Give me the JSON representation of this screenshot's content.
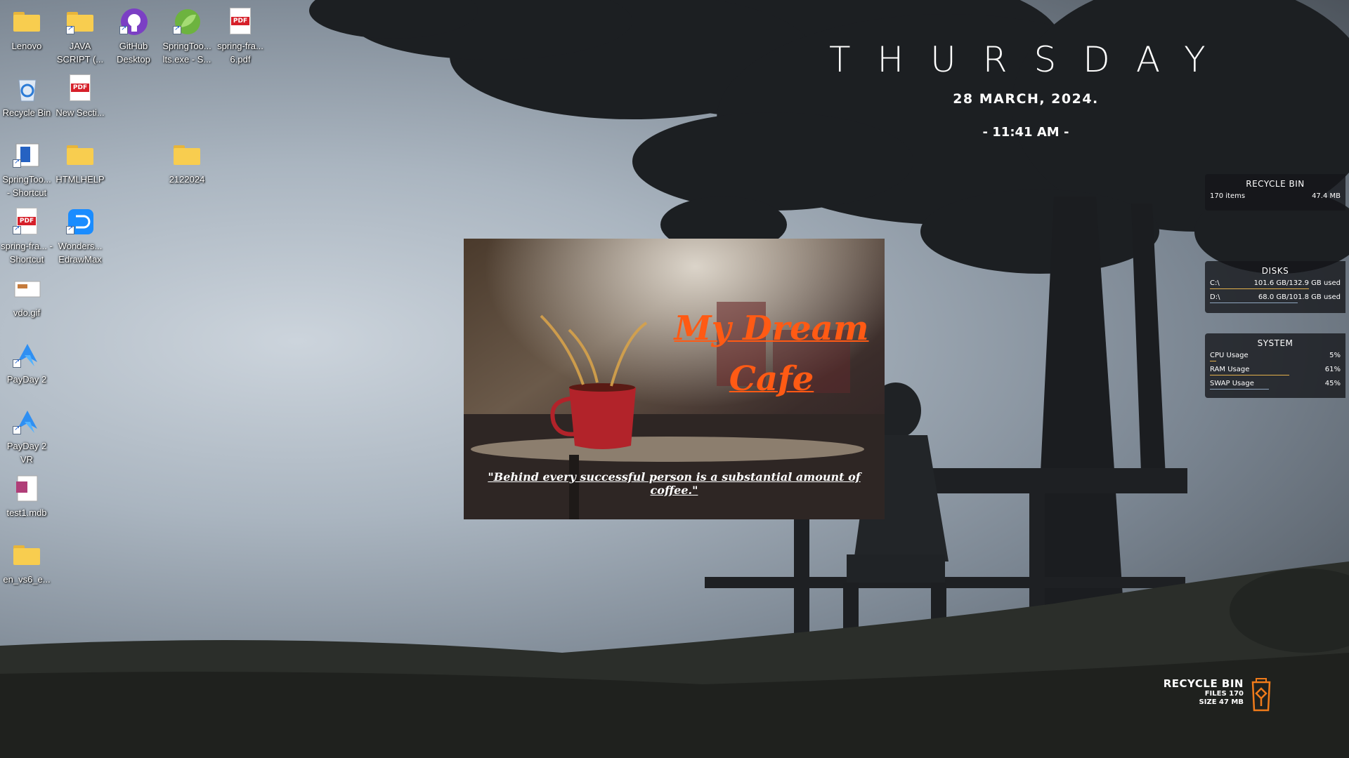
{
  "desktop_icons": [
    {
      "id": "lenovo",
      "label": "Lenovo",
      "icon": "folder-icon"
    },
    {
      "id": "javascript",
      "label": "JAVA SCRIPT (...",
      "icon": "folder-icon"
    },
    {
      "id": "github",
      "label": "GitHub Desktop",
      "icon": "github-icon"
    },
    {
      "id": "springtools-exe",
      "label": "SpringToo... lts.exe - S...",
      "icon": "spring-leaf-icon"
    },
    {
      "id": "spring-pdf",
      "label": "spring-fra... 6.pdf",
      "icon": "pdf-icon"
    },
    {
      "id": "recycle-bin",
      "label": "Recycle Bin",
      "icon": "recycle-bin-icon"
    },
    {
      "id": "new-section",
      "label": "New Secti...",
      "icon": "pdf-icon"
    },
    {
      "id": "springtools-shortcut",
      "label": "SpringToo... - Shortcut",
      "icon": "app-icon"
    },
    {
      "id": "htmlhelp",
      "label": "HTMLHELP",
      "icon": "folder-icon"
    },
    {
      "id": "folder-2122024",
      "label": "2122024",
      "icon": "folder-icon"
    },
    {
      "id": "spring-shortcut",
      "label": "spring-fra... - Shortcut",
      "icon": "pdf-icon"
    },
    {
      "id": "edrawmax",
      "label": "Wonders... EdrawMax",
      "icon": "edrawmax-icon"
    },
    {
      "id": "vdo-gif",
      "label": "vdo.gif",
      "icon": "image-icon"
    },
    {
      "id": "payday2",
      "label": "PayDay 2",
      "icon": "payday-icon"
    },
    {
      "id": "payday2vr",
      "label": "PayDay 2 VR",
      "icon": "payday-icon"
    },
    {
      "id": "test1-mdb",
      "label": "test1.mdb",
      "icon": "database-file-icon"
    },
    {
      "id": "en-vs6",
      "label": "en_vs6_e...",
      "icon": "zip-folder-icon"
    }
  ],
  "clock_widget": {
    "day": "THURSDAY",
    "date": "28 MARCH, 2024.",
    "time": "- 11:41 AM -"
  },
  "recycle_panel": {
    "title": "RECYCLE BIN",
    "items": "170 items",
    "size": "47.4 MB"
  },
  "disks_panel": {
    "title": "DISKS",
    "rows": [
      {
        "drive": "C:\\",
        "usage": "101.6 GB/132.9 GB used",
        "fraction": 0.76
      },
      {
        "drive": "D:\\",
        "usage": "68.0 GB/101.8 GB used",
        "fraction": 0.67
      }
    ]
  },
  "system_panel": {
    "title": "SYSTEM",
    "rows": [
      {
        "label": "CPU Usage",
        "value": "5%",
        "fraction": 0.05
      },
      {
        "label": "RAM Usage",
        "value": "61%",
        "fraction": 0.61
      },
      {
        "label": "SWAP Usage",
        "value": "45%",
        "fraction": 0.45
      }
    ]
  },
  "cafe_picture": {
    "title_line1": "My Dream",
    "title_line2": "Cafe",
    "quote": "\"Behind every successful person is a substantial amount of coffee.\""
  },
  "recycle_widget": {
    "title": "RECYCLE BIN",
    "files": "FILES 170",
    "size": "SIZE 47 MB"
  },
  "colors": {
    "accent_orange": "#ff5a14",
    "bar_gold": "#e3b04b"
  }
}
